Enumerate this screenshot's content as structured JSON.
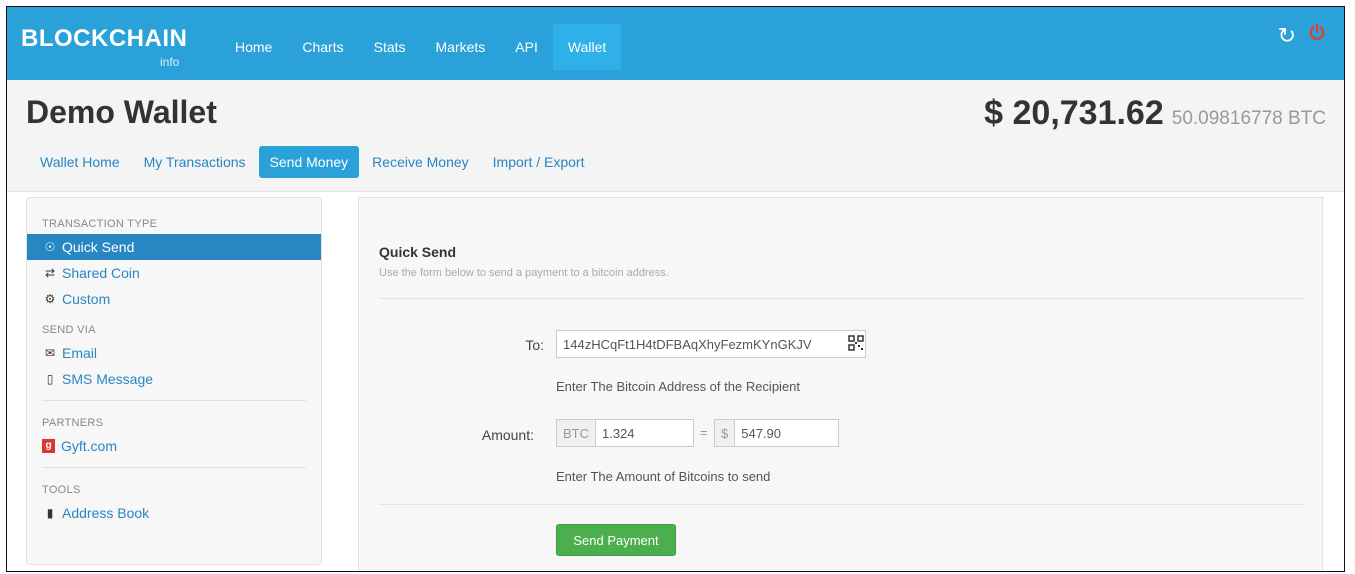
{
  "brand": {
    "name": "BLOCKCHAIN",
    "sub": "info"
  },
  "nav": {
    "items": [
      "Home",
      "Charts",
      "Stats",
      "Markets",
      "API",
      "Wallet"
    ],
    "active": "Wallet"
  },
  "header": {
    "title": "Demo Wallet",
    "balance_usd": "$ 20,731.62",
    "balance_btc": "50.09816778 BTC"
  },
  "tabs": [
    "Wallet Home",
    "My Transactions",
    "Send Money",
    "Receive Money",
    "Import / Export"
  ],
  "sidebar": {
    "transaction_type": {
      "title": "TRANSACTION TYPE",
      "items": [
        "Quick Send",
        "Shared Coin",
        "Custom"
      ]
    },
    "send_via": {
      "title": "SEND VIA",
      "items": [
        "Email",
        "SMS Message"
      ]
    },
    "partners": {
      "title": "PARTNERS",
      "items": [
        "Gyft.com"
      ]
    },
    "tools": {
      "title": "TOOLS",
      "items": [
        "Address Book"
      ]
    }
  },
  "form": {
    "title": "Quick Send",
    "subtitle": "Use the form below to send a payment to a bitcoin address.",
    "to_label": "To:",
    "to_value": "144zHCqFt1H4tDFBAqXhyFezmKYnGKJV",
    "to_help": "Enter The Bitcoin Address of the Recipient",
    "amount_label": "Amount:",
    "btc_addon": "BTC",
    "btc_value": "1.324",
    "equals": "=",
    "usd_addon": "$",
    "usd_value": "547.90",
    "amount_help": "Enter The Amount of Bitcoins to send",
    "submit": "Send Payment"
  },
  "colors": {
    "primary": "#2aa1d8",
    "link": "#2787c3",
    "success": "#4cae4c",
    "power": "#e0412e"
  }
}
